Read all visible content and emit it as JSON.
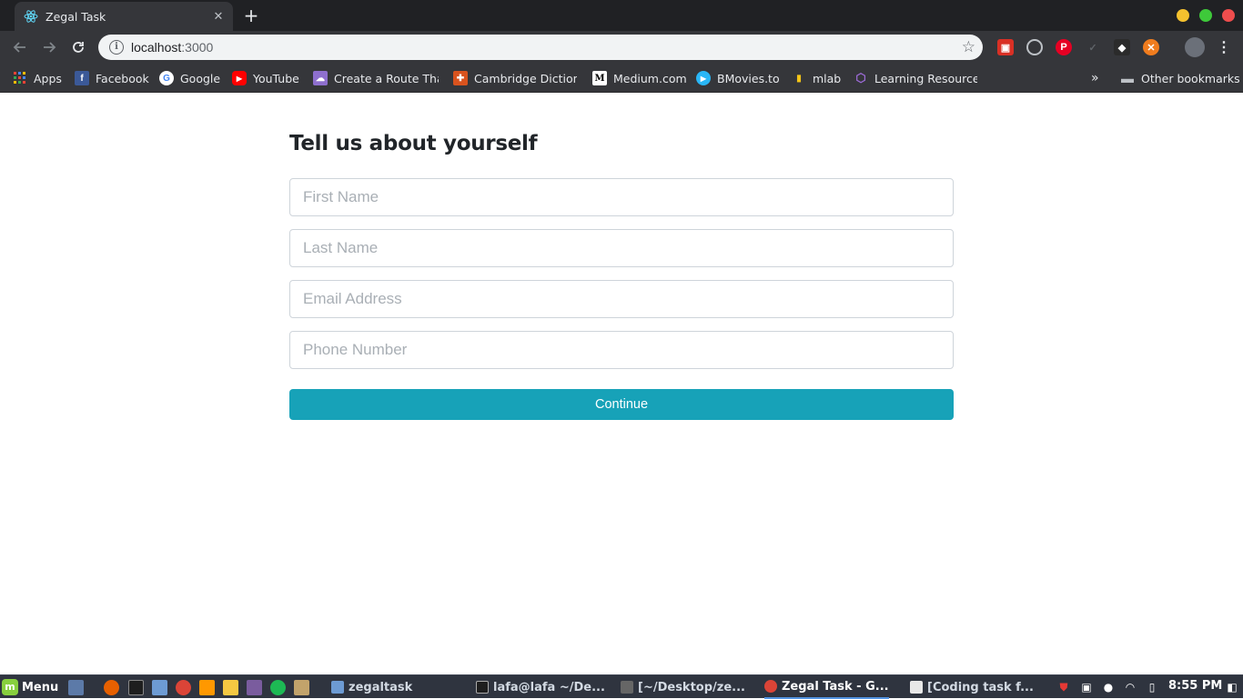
{
  "browser": {
    "tab_title": "Zegal Task",
    "url_host": "localhost",
    "url_port": ":3000"
  },
  "bookmarks": [
    {
      "label": "Apps",
      "icon": "apps-grid-icon",
      "color": "#4285f4"
    },
    {
      "label": "Facebook",
      "icon": "facebook-icon",
      "color": "#3b5998"
    },
    {
      "label": "Google",
      "icon": "google-icon",
      "color": "#ffffff"
    },
    {
      "label": "YouTube",
      "icon": "youtube-icon",
      "color": "#ff0000"
    },
    {
      "label": "Create a Route That",
      "icon": "cloud-icon",
      "color": "#8e6fce"
    },
    {
      "label": "Cambridge Dictiona",
      "icon": "cambridge-crest-icon",
      "color": "#d9531e"
    },
    {
      "label": "Medium.com",
      "icon": "medium-icon",
      "color": "#ffffff"
    },
    {
      "label": "BMovies.to",
      "icon": "play-icon",
      "color": "#29b6f6"
    },
    {
      "label": "mlab",
      "icon": "mlab-icon",
      "color": "#f5c518"
    },
    {
      "label": "Learning Resources",
      "icon": "graphql-icon",
      "color": "#9c6bd6"
    }
  ],
  "other_bookmarks": "Other bookmarks",
  "form": {
    "title": "Tell us about yourself",
    "first_name_placeholder": "First Name",
    "last_name_placeholder": "Last Name",
    "email_placeholder": "Email Address",
    "phone_placeholder": "Phone Number",
    "continue_label": "Continue"
  },
  "taskbar": {
    "menu_label": "Menu",
    "windows": [
      {
        "label": "zegaltask",
        "icon": "folder-icon"
      },
      {
        "label": "lafa@lafa ~/De...",
        "icon": "terminal-icon"
      },
      {
        "label": "[~/Desktop/ze...",
        "icon": "sublime-icon"
      },
      {
        "label": "Zegal Task - G...",
        "icon": "chrome-icon",
        "active": true
      },
      {
        "label": "[Coding task f...",
        "icon": "document-icon"
      }
    ],
    "clock": "8:55 PM"
  },
  "colors": {
    "accent_button": "#17a2b8",
    "chrome_dark": "#35363a",
    "taskbar": "#2f343f"
  }
}
